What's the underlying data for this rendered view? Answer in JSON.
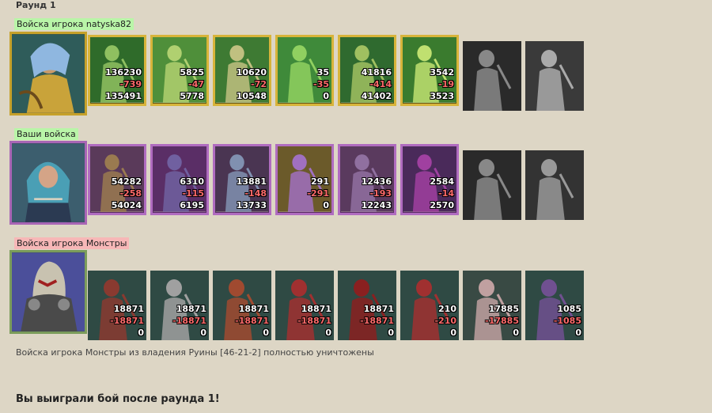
{
  "round_title": "Раунд 1",
  "labels": {
    "enemy": "Войска игрока natyska82",
    "yours": "Ваши войска",
    "monsters": "Войска игрока Монстры"
  },
  "rows": [
    {
      "name": "enemy",
      "frame": "gold",
      "units": [
        {
          "start": "136230",
          "loss": "-739",
          "end": "135491"
        },
        {
          "start": "5825",
          "loss": "-47",
          "end": "5778"
        },
        {
          "start": "10620",
          "loss": "-72",
          "end": "10548"
        },
        {
          "start": "35",
          "loss": "-35",
          "end": "0"
        },
        {
          "start": "41816",
          "loss": "-414",
          "end": "41402"
        },
        {
          "start": "3542",
          "loss": "-19",
          "end": "3523"
        },
        {
          "start": "",
          "loss": "",
          "end": ""
        },
        {
          "start": "",
          "loss": "",
          "end": ""
        }
      ]
    },
    {
      "name": "yours",
      "frame": "purple",
      "units": [
        {
          "start": "54282",
          "loss": "-258",
          "end": "54024"
        },
        {
          "start": "6310",
          "loss": "-115",
          "end": "6195"
        },
        {
          "start": "13881",
          "loss": "-148",
          "end": "13733"
        },
        {
          "start": "291",
          "loss": "-291",
          "end": "0"
        },
        {
          "start": "12436",
          "loss": "-193",
          "end": "12243"
        },
        {
          "start": "2584",
          "loss": "-14",
          "end": "2570"
        },
        {
          "start": "",
          "loss": "",
          "end": ""
        },
        {
          "start": "",
          "loss": "",
          "end": ""
        }
      ]
    },
    {
      "name": "monsters",
      "frame": "plain",
      "units": [
        {
          "start": "18871",
          "loss": "-18871",
          "end": "0"
        },
        {
          "start": "18871",
          "loss": "-18871",
          "end": "0"
        },
        {
          "start": "18871",
          "loss": "-18871",
          "end": "0"
        },
        {
          "start": "18871",
          "loss": "-18871",
          "end": "0"
        },
        {
          "start": "18871",
          "loss": "-18871",
          "end": "0"
        },
        {
          "start": "210",
          "loss": "-210",
          "end": "0"
        },
        {
          "start": "17885",
          "loss": "-17885",
          "end": "0"
        },
        {
          "start": "1085",
          "loss": "-1085",
          "end": "0"
        }
      ]
    }
  ],
  "footer_message": "Войска игрока Монстры из владения Руины [46-21-2] полностью уничтожены",
  "win_message": "Вы выиграли бой после раунда 1!",
  "colors": {
    "background": "#ddd6c5",
    "label_green": "#b9f5a8",
    "label_pink": "#f7b7b7",
    "frame_gold": "#d7b43a",
    "frame_purple": "#b06cc0",
    "loss_red": "#ff6a6a"
  }
}
